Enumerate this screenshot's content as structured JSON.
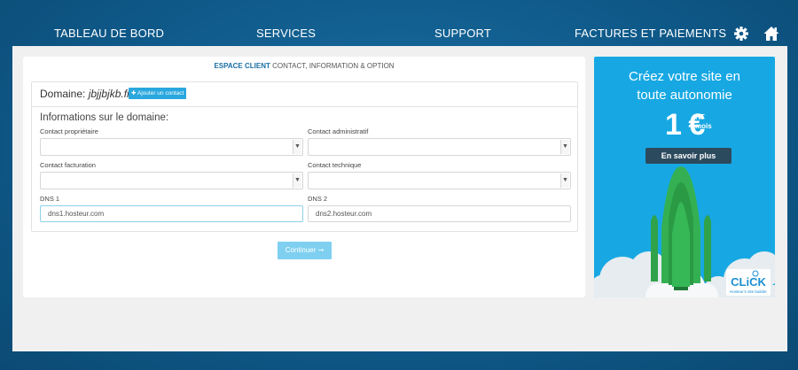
{
  "nav": {
    "items": [
      "TABLEAU DE BORD",
      "SERVICES",
      "SUPPORT",
      "FACTURES ET PAIEMENTS"
    ],
    "icons": [
      "gear-icon",
      "home-icon"
    ]
  },
  "form": {
    "header_strong": "ESPACE CLIENT",
    "header_rest": " CONTACT, INFORMATION & OPTION",
    "domain_label": "Domaine: ",
    "domain_value": "jbjjbjkb.fr",
    "add_contact_label": "✚ Ajouter un contact",
    "section_title": "Informations sur le domaine:",
    "fields": {
      "owner_label": "Contact propriétaire",
      "admin_label": "Contact administratif",
      "billing_label": "Contact facturation",
      "tech_label": "Contact technique",
      "dns1_label": "DNS 1",
      "dns1_value": "dns1.hosteur.com",
      "dns2_label": "DNS 2",
      "dns2_value": "dns2.hosteur.com"
    },
    "continue_label": "Continuer ➞"
  },
  "ad": {
    "title_line1": "Créez votre site en",
    "title_line2": "toute autonomie",
    "price_big": "1 €",
    "price_sup1": "HT",
    "price_sup2": "mois",
    "cta": "En savoir plus",
    "logo_text": "CLiCK",
    "logo_sub": "Hosteur's site builder"
  },
  "colors": {
    "background": "#0f5a8a",
    "accent": "#29a7de",
    "ad_background": "#17a8e3",
    "rocket": "#2fa24a"
  }
}
